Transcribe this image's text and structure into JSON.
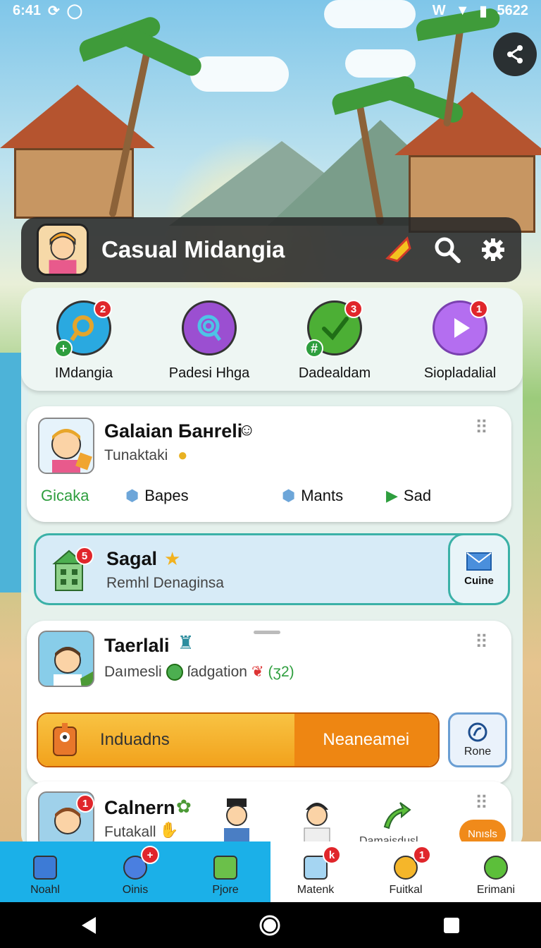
{
  "status_bar": {
    "time": "6:41",
    "left_icons": [
      "cast-icon",
      "circle-icon"
    ],
    "battery": "5622",
    "right_icons": [
      "wifi-alt-icon",
      "wifi-icon",
      "battery-icon"
    ]
  },
  "header": {
    "title": "Casual Midangia",
    "icons": [
      "kite-icon",
      "search-icon",
      "gear-icon"
    ]
  },
  "share": {
    "icon": "share-icon"
  },
  "quick_actions": [
    {
      "label": "IMdangia",
      "badge": "2",
      "icon": "key-icon",
      "color": "#2aa9e0",
      "extra": "+"
    },
    {
      "label": "Padesi Hhga",
      "badge": "",
      "icon": "magnifier-icon",
      "color": "#9b4fd1",
      "extra": ""
    },
    {
      "label": "Dadealdam",
      "badge": "3",
      "icon": "check-icon",
      "color": "#4caf35",
      "extra": "#"
    },
    {
      "label": "Siopladalial",
      "badge": "1",
      "icon": "play-icon",
      "color": "#b46ef0",
      "extra": ""
    }
  ],
  "card1": {
    "title": "Galaian Банreli",
    "subtitle": "Tunaktaki",
    "stats": [
      {
        "label": "Gicaka",
        "icon": ""
      },
      {
        "label": "Bapes",
        "icon": "hex-icon"
      },
      {
        "label": "Mants",
        "icon": "hex-icon"
      },
      {
        "label": "Sad",
        "icon": "play-icon"
      }
    ]
  },
  "mail_card": {
    "title": "Sagal",
    "badge": "5",
    "subtitle": "Remhl Denaginsa",
    "button_label": "Cuine"
  },
  "card2": {
    "title": "Taerlali",
    "subtitle": "Daımesli",
    "subtitle2": "ſadgation",
    "subtitle3": "(ʒ2)",
    "progress_label": "Induadns",
    "progress_fraction": 0.64,
    "progress_right_label": "Neaneamei",
    "button_label": "Rone"
  },
  "card3": {
    "title": "Calnern",
    "subtitle": "Futakall",
    "badge": "1",
    "partial_label": "Damaisdusl",
    "button_label": "Nnısls"
  },
  "bottom_nav": [
    {
      "label": "Noahl",
      "active": true,
      "badge": ""
    },
    {
      "label": "Oinis",
      "active": true,
      "badge": "+"
    },
    {
      "label": "Pjore",
      "active": true,
      "badge": ""
    },
    {
      "label": "Matenk",
      "active": false,
      "badge": "k"
    },
    {
      "label": "Fuitkal",
      "active": false,
      "badge": "1"
    },
    {
      "label": "Erimani",
      "active": false,
      "badge": ""
    }
  ],
  "colors": {
    "accent": "#1bb0e8",
    "badge_red": "#e0262b",
    "green_text": "#2e9e3e",
    "orange": "#ee8612"
  }
}
